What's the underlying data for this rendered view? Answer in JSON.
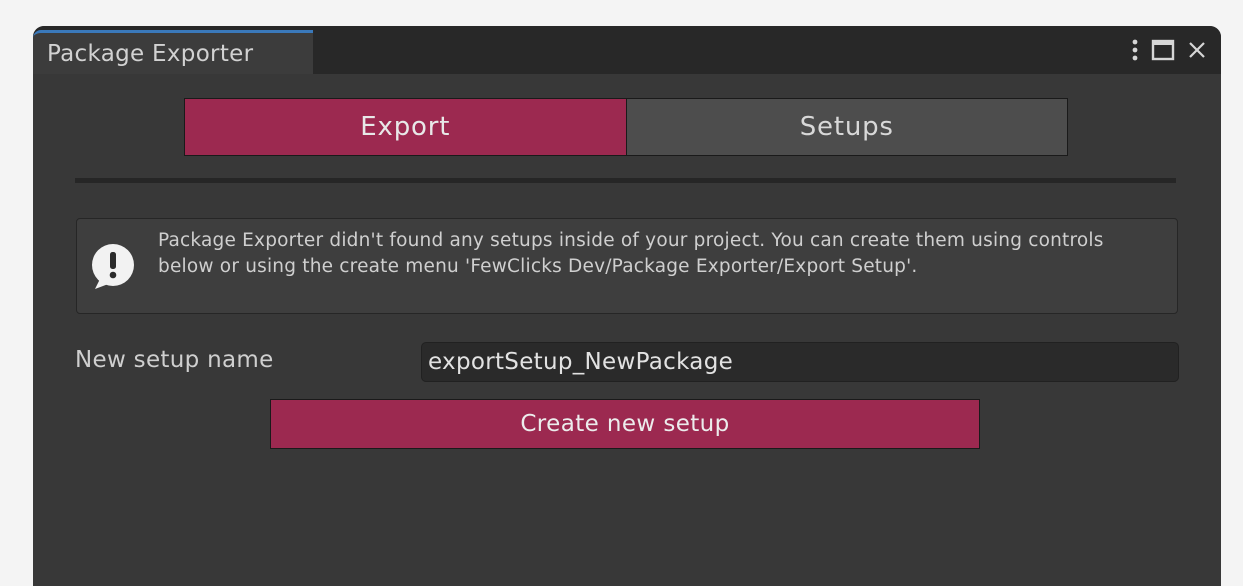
{
  "window": {
    "tab_title": "Package Exporter",
    "controls": {
      "more_icon": "kebab-vertical-icon",
      "maximize_icon": "maximize-icon",
      "close_icon": "close-icon"
    }
  },
  "tabs": [
    {
      "label": "Export",
      "active": true
    },
    {
      "label": "Setups",
      "active": false
    }
  ],
  "helpbox": {
    "icon": "info-speech-bubble-icon",
    "message": "Package Exporter didn't found any setups inside of your project. You can create them using controls below or using the create menu 'FewClicks Dev/Package Exporter/Export Setup'."
  },
  "new_setup": {
    "label": "New setup name",
    "value": "exportSetup_NewPackage"
  },
  "create_button": {
    "label": "Create new setup"
  },
  "colors": {
    "accent": "#9c2950",
    "tab_indicator": "#3a79bb",
    "background": "#383838"
  }
}
